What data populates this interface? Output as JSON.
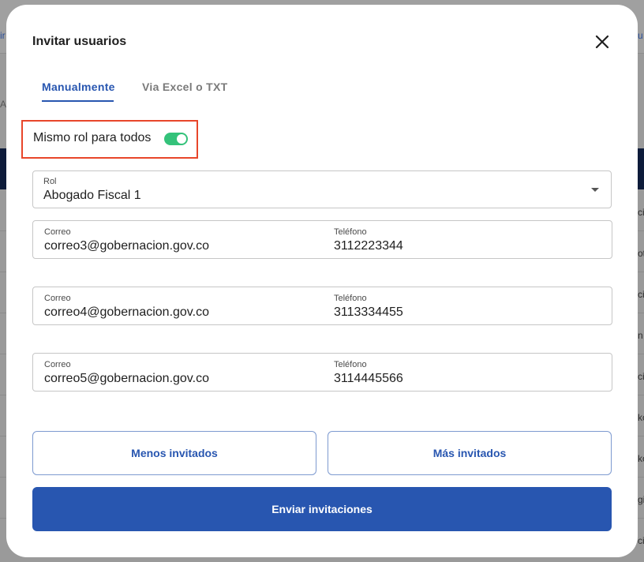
{
  "background": {
    "edge_texts_left": [
      "ir",
      "AS"
    ],
    "edge_texts_right": [
      "u",
      "ci",
      "ot",
      "ci",
      "n",
      "ci",
      "ko",
      "ko",
      "gi",
      "ci"
    ]
  },
  "modal": {
    "title": "Invitar usuarios",
    "close_icon": "close-icon",
    "tabs": [
      {
        "label": "Manualmente",
        "active": true
      },
      {
        "label": "Via Excel o TXT",
        "active": false
      }
    ],
    "same_role": {
      "label": "Mismo rol para todos",
      "enabled": true
    },
    "role": {
      "label": "Rol",
      "value": "Abogado Fiscal 1"
    },
    "invitees": [
      {
        "email_label": "Correo",
        "email": "correo3@gobernacion.gov.co",
        "phone_label": "Teléfono",
        "phone": "3112223344"
      },
      {
        "email_label": "Correo",
        "email": "correo4@gobernacion.gov.co",
        "phone_label": "Teléfono",
        "phone": "3113334455"
      },
      {
        "email_label": "Correo",
        "email": "correo5@gobernacion.gov.co",
        "phone_label": "Teléfono",
        "phone": "3114445566"
      }
    ],
    "buttons": {
      "less": "Menos invitados",
      "more": "Más invitados",
      "send": "Enviar invitaciones"
    }
  },
  "colors": {
    "primary": "#2856b0",
    "toggle_on": "#34c27a",
    "highlight": "#e8462a"
  }
}
